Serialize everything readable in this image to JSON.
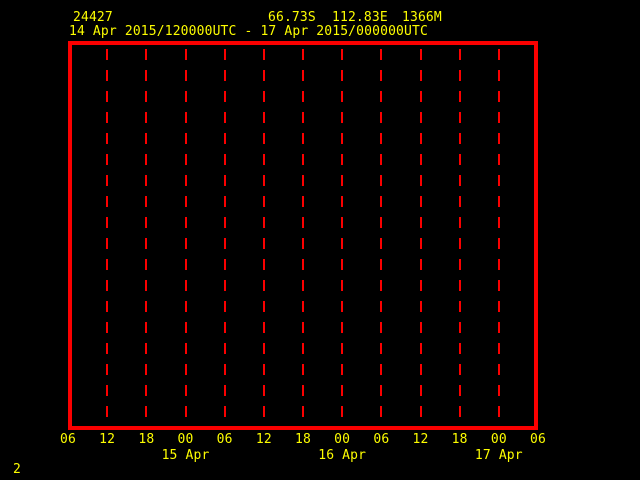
{
  "colors": {
    "background": "#000000",
    "frame_red": "#fb0000",
    "grid_red": "#fb0000",
    "label_yellow": "#fdfd00"
  },
  "header": {
    "station_id": "24427",
    "latitude": "66.73S",
    "longitude": "112.83E",
    "elevation": "1366M",
    "time_range": "14 Apr 2015/120000UTC - 17 Apr 2015/000000UTC"
  },
  "footer": {
    "page_number": "2"
  },
  "chart_data": {
    "type": "line",
    "title": "",
    "xlabel": "",
    "ylabel": "",
    "x_tick_labels": [
      "06",
      "12",
      "18",
      "00",
      "06",
      "12",
      "18",
      "00",
      "06",
      "12",
      "18",
      "00",
      "06"
    ],
    "x_date_labels": [
      {
        "label": "15 Apr",
        "tick_index": 3
      },
      {
        "label": "16 Apr",
        "tick_index": 7
      },
      {
        "label": "17 Apr",
        "tick_index": 11
      }
    ],
    "series": [],
    "grid": {
      "vertical_dashed_lines_at_interior_ticks": true,
      "horizontal_lines": false
    },
    "legend": "none",
    "plot_area_empty": true
  }
}
